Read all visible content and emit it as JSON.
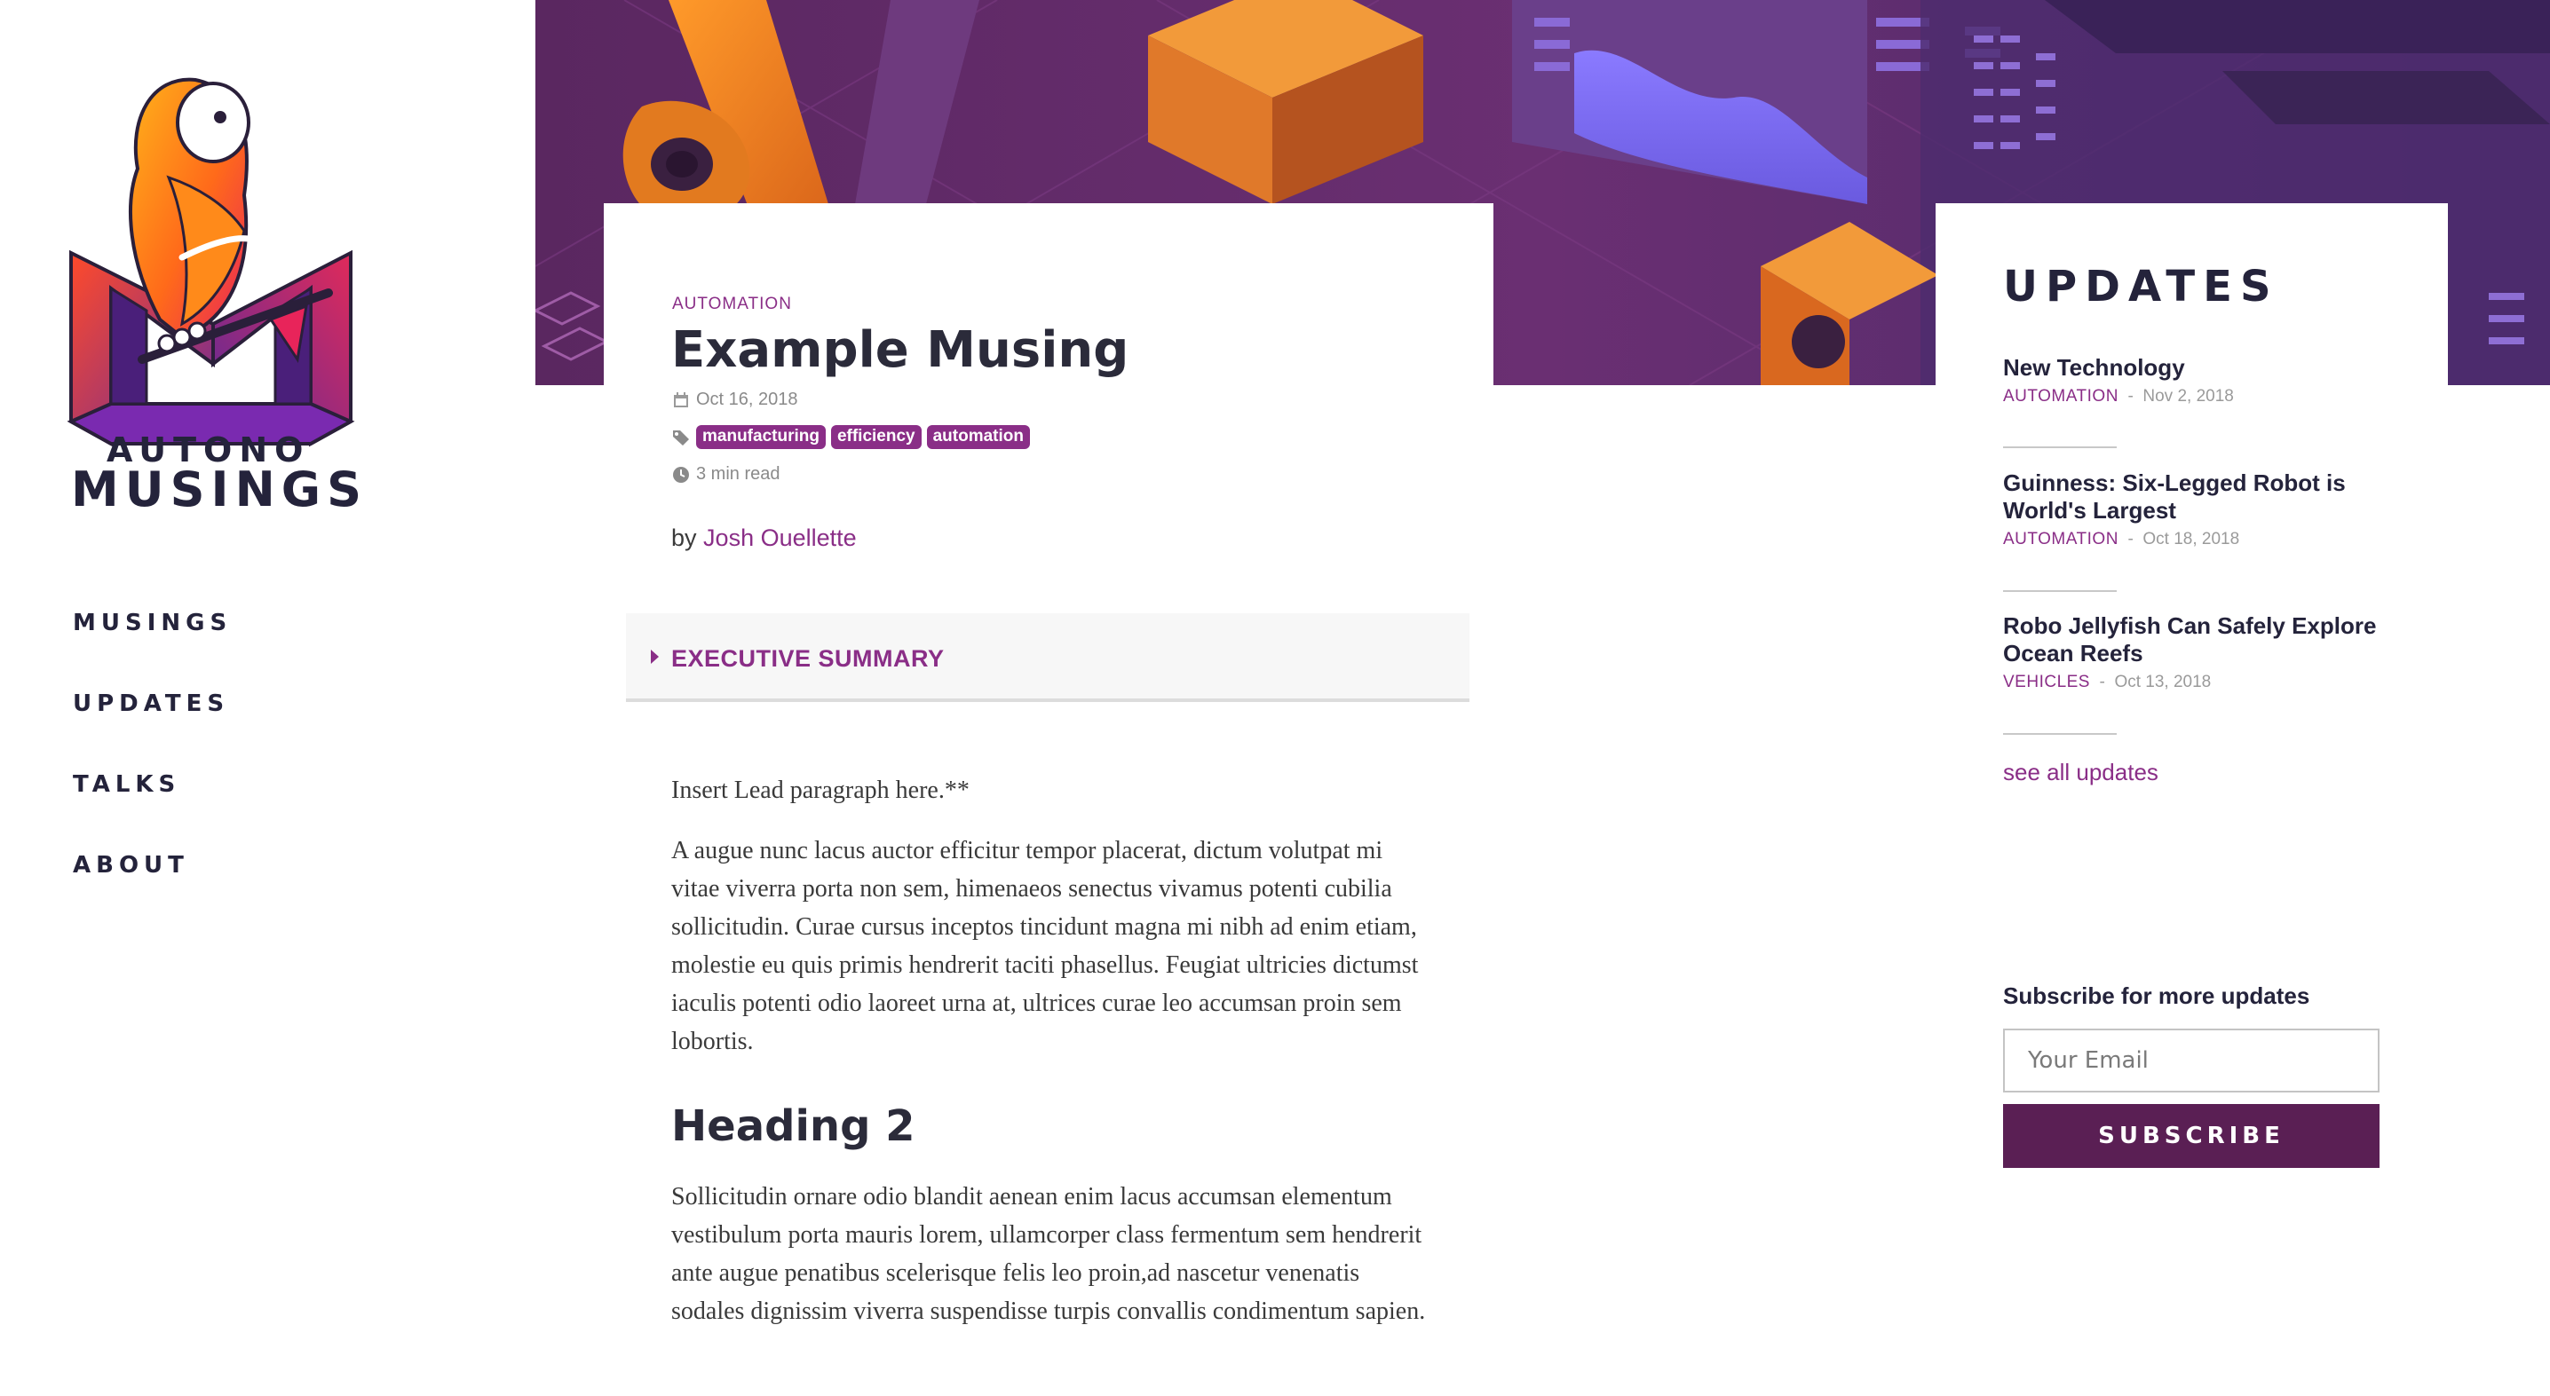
{
  "brand": {
    "line1": "AUTONO",
    "line2": "MUSINGS",
    "colors": {
      "primary": "#8a2e87",
      "dark": "#24233b",
      "button": "#5a1f54"
    }
  },
  "nav": {
    "items": [
      {
        "label": "MUSINGS"
      },
      {
        "label": "UPDATES"
      },
      {
        "label": "TALKS"
      },
      {
        "label": "ABOUT"
      }
    ]
  },
  "article": {
    "category": "AUTOMATION",
    "title": "Example Musing",
    "date": "Oct 16, 2018",
    "tags": [
      "manufacturing",
      "efficiency",
      "automation"
    ],
    "read_time": "3 min read",
    "by_prefix": "by",
    "author": "Josh Ouellette",
    "summary_label": "EXECUTIVE SUMMARY",
    "lead": "Insert Lead paragraph here.**",
    "paragraph1": "A augue nunc lacus auctor efficitur tempor placerat, dictum volutpat mi vitae viverra porta non sem, himenaeos senectus vivamus potenti cubilia sollicitudin. Curae cursus inceptos tincidunt magna mi nibh ad enim etiam, molestie eu quis primis hendrerit taciti phasellus. Feugiat ultricies dictumst iaculis potenti odio laoreet urna at, ultrices curae leo accumsan proin sem lobortis.",
    "heading2": "Heading 2",
    "paragraph2": "Sollicitudin ornare odio blandit aenean enim lacus accumsan elementum vestibulum porta mauris lorem, ullamcorper class fermentum sem hendrerit ante augue penatibus scelerisque felis leo proin,ad nascetur venenatis sodales dignissim viverra suspendisse turpis convallis condimentum sapien."
  },
  "updates": {
    "title": "UPDATES",
    "items": [
      {
        "title": "New Technology",
        "category": "AUTOMATION",
        "date": "Nov 2, 2018"
      },
      {
        "title": "Guinness: Six-Legged Robot is World's Largest",
        "category": "AUTOMATION",
        "date": "Oct 18, 2018"
      },
      {
        "title": "Robo Jellyfish Can Safely Explore Ocean Reefs",
        "category": "VEHICLES",
        "date": "Oct 13, 2018"
      }
    ],
    "see_all": "see all updates",
    "separator": "-"
  },
  "subscribe": {
    "title": "Subscribe for more updates",
    "placeholder": "Your Email",
    "value": "",
    "button_label": "SUBSCRIBE"
  }
}
